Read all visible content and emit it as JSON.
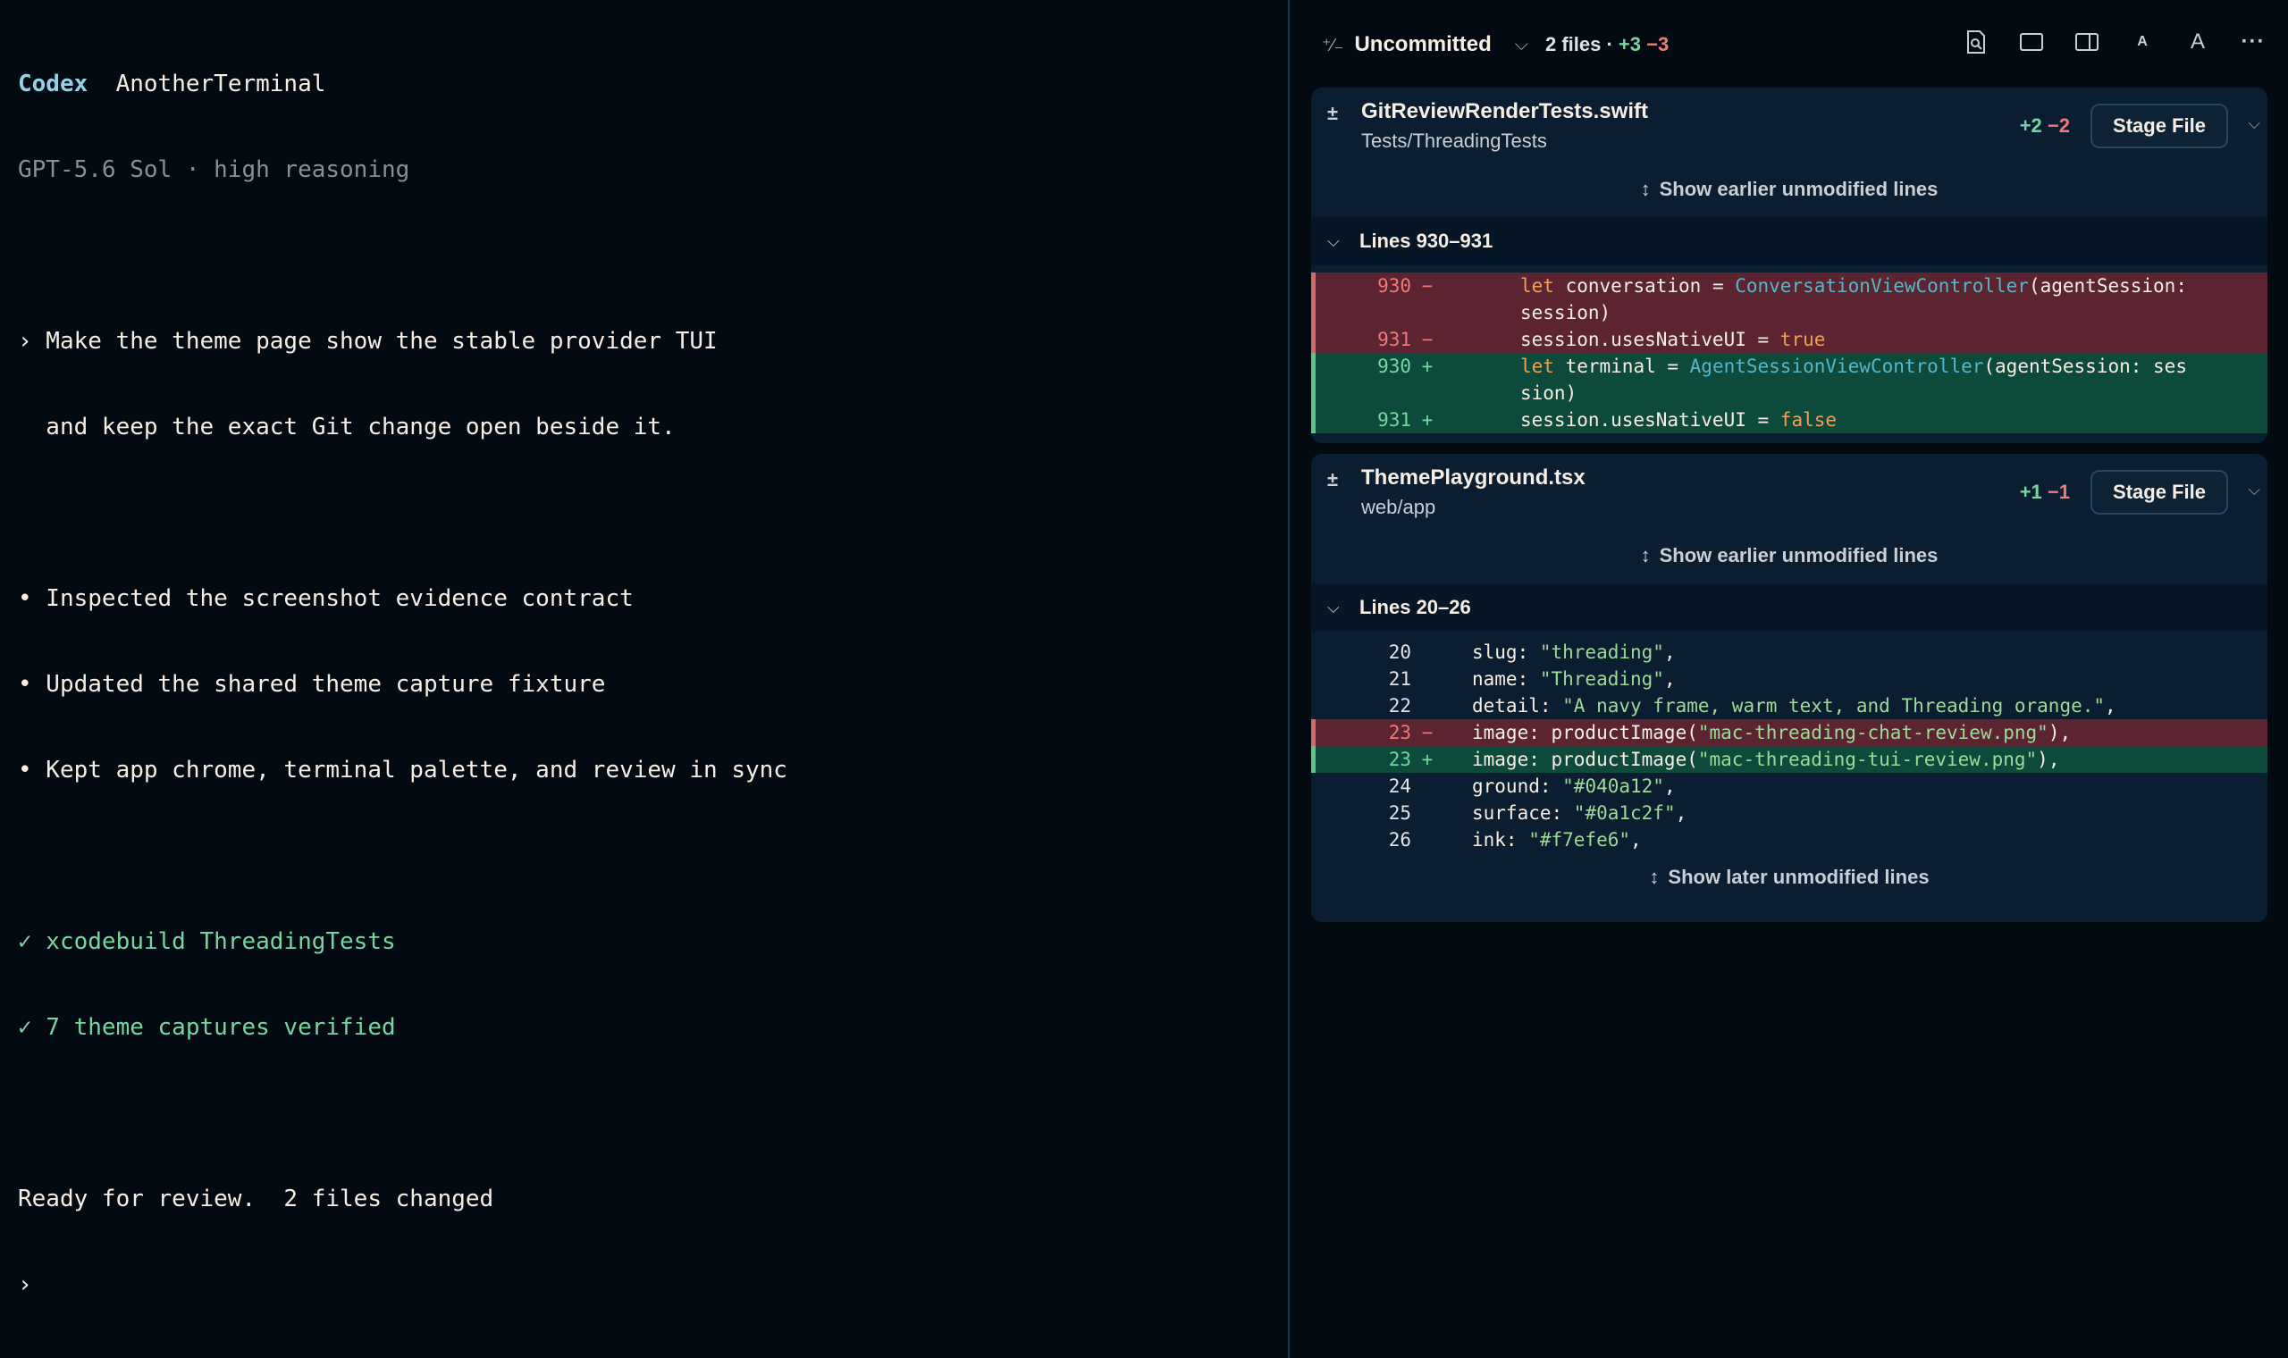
{
  "terminal": {
    "brand": "Codex",
    "app_name": "AnotherTerminal",
    "model_line": "GPT-5.6 Sol · high reasoning",
    "prompt_line1": "› Make the theme page show the stable provider TUI",
    "prompt_line2": "  and keep the exact Git change open beside it.",
    "bullets": [
      "• Inspected the screenshot evidence contract",
      "• Updated the shared theme capture fixture",
      "• Kept app chrome, terminal palette, and review in sync"
    ],
    "checks": [
      "✓ xcodebuild ThreadingTests",
      "✓ 7 theme captures verified"
    ],
    "status": "Ready for review.  2 files changed",
    "cursor": "›"
  },
  "review": {
    "branch_label": "Uncommitted",
    "diff_glyph": "⁺⁄₋",
    "files_summary": "2 files · ",
    "added": "+3",
    "removed": "−3",
    "toolbar_icons": [
      "search-doc-icon",
      "single-pane-icon",
      "split-pane-icon",
      "font-smaller-icon",
      "font-larger-icon",
      "more-icon"
    ],
    "font_small_glyph": "A",
    "font_large_glyph": "A",
    "more_glyph": "···",
    "files": [
      {
        "marker": "±",
        "name": "GitReviewRenderTests.swift",
        "path": "Tests/ThreadingTests",
        "added": "+2",
        "removed": "−2",
        "stage_label": "Stage File",
        "show_earlier": "Show earlier unmodified lines",
        "hunk_title": "Lines 930–931"
      },
      {
        "marker": "±",
        "name": "ThemePlayground.tsx",
        "path": "web/app",
        "added": "+1",
        "removed": "−1",
        "stage_label": "Stage File",
        "show_earlier": "Show earlier unmodified lines",
        "hunk_title": "Lines 20–26",
        "show_later": "Show later unmodified lines"
      }
    ],
    "hunk1": [
      {
        "kind": "del",
        "ln": "930",
        "mk": "−",
        "kw": "let",
        "pre": " conversation = ",
        "ty": "ConversationViewController",
        "post": "(agentSession:"
      },
      {
        "kind": "del",
        "ln": "",
        "mk": "",
        "text": "session)"
      },
      {
        "kind": "del",
        "ln": "931",
        "mk": "−",
        "pre": "session.usesNativeUI = ",
        "kw": "true"
      },
      {
        "kind": "add",
        "ln": "930",
        "mk": "+",
        "kw": "let",
        "pre": " terminal = ",
        "ty": "AgentSessionViewController",
        "post": "(agentSession: ses"
      },
      {
        "kind": "add",
        "ln": "",
        "mk": "",
        "text": "sion)"
      },
      {
        "kind": "add",
        "ln": "931",
        "mk": "+",
        "pre": "session.usesNativeUI = ",
        "kw": "false"
      }
    ],
    "hunk2": [
      {
        "kind": "ctx",
        "ln": "20",
        "mk": "",
        "pre": "slug: ",
        "str": "\"threading\"",
        "post": ","
      },
      {
        "kind": "ctx",
        "ln": "21",
        "mk": "",
        "pre": "name: ",
        "str": "\"Threading\"",
        "post": ","
      },
      {
        "kind": "ctx",
        "ln": "22",
        "mk": "",
        "pre": "detail: ",
        "str": "\"A navy frame, warm text, and Threading orange.\"",
        "post": ","
      },
      {
        "kind": "del",
        "ln": "23",
        "mk": "−",
        "pre": "image: productImage(",
        "str": "\"mac-threading-chat-review.png\"",
        "post": "),"
      },
      {
        "kind": "add",
        "ln": "23",
        "mk": "+",
        "pre": "image: productImage(",
        "str": "\"mac-threading-tui-review.png\"",
        "post": "),"
      },
      {
        "kind": "ctx",
        "ln": "24",
        "mk": "",
        "pre": "ground: ",
        "str": "\"#040a12\"",
        "post": ","
      },
      {
        "kind": "ctx",
        "ln": "25",
        "mk": "",
        "pre": "surface: ",
        "str": "\"#0a1c2f\"",
        "post": ","
      },
      {
        "kind": "ctx",
        "ln": "26",
        "mk": "",
        "pre": "ink: ",
        "str": "\"#f7efe6\"",
        "post": ","
      }
    ]
  },
  "colors": {
    "background": "#040a12",
    "card": "#0b1d30",
    "added": "#76d6a0",
    "removed": "#f07a7a",
    "keyword": "#f0a050",
    "type": "#58b6c8",
    "string": "#9fd99a",
    "brand": "#8fd4e8"
  }
}
